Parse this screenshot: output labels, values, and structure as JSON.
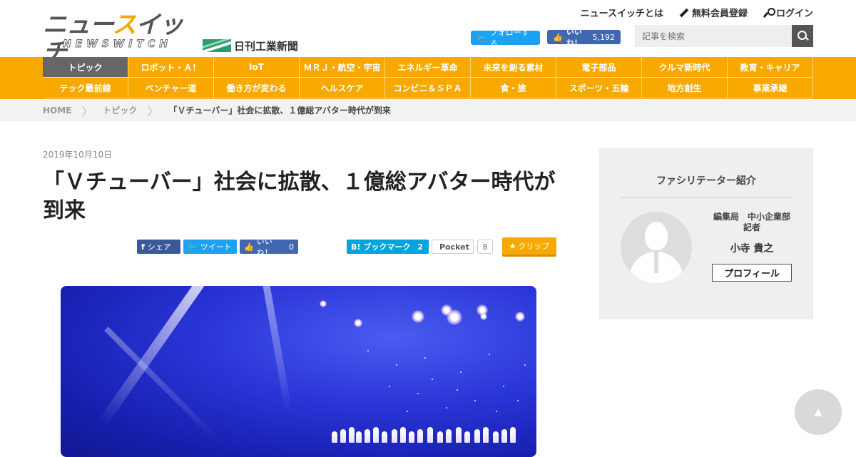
{
  "header": {
    "logo_text_a": "ニュー",
    "logo_text_hl": "ス",
    "logo_text_b": "イッチ",
    "logo_sub": "NEWSWITCH",
    "nikkan": "日刊工業新聞",
    "links": {
      "about": "ニュースイッチとは",
      "register": "無料会員登録",
      "login": "ログイン"
    },
    "twitter_follow": "フォローする",
    "fb_like": "いいね！",
    "fb_like_count": "5,192",
    "search_placeholder": "記事を検索"
  },
  "nav": {
    "items": [
      "トピック",
      "ロボット・Ａ！",
      "IoT",
      "ＭＲＪ・航空・宇宙",
      "エネルギー革命",
      "未来を創る素材",
      "電子部品",
      "クルマ新時代",
      "教育・キャリア",
      "テック最前線",
      "ベンチャー道",
      "働き方が変わる",
      "ヘルスケア",
      "コンビニ＆ＳＰＡ",
      "食・旅",
      "スポーツ・五輪",
      "地方創生",
      "事業承継"
    ],
    "active": "トピック"
  },
  "breadcrumb": {
    "home": "HOME",
    "section": "トピック",
    "current": "「Ｖチューバー」社会に拡散、１億総アバター時代が到来"
  },
  "article": {
    "date": "2019年10月10日",
    "title": "「Ｖチューバー」社会に拡散、１億総アバター時代が到来"
  },
  "share": {
    "fb": "シェア",
    "tw": "ツイート",
    "like": "いいね！",
    "like_count": "0",
    "hatena": "ブックマーク",
    "hatena_count": "2",
    "pocket": "Pocket",
    "pocket_count": "8",
    "clip": "クリップ"
  },
  "sidebar": {
    "title": "ファシリテーター紹介",
    "dept_line1": "編集局　中小企業部",
    "dept_line2": "記者",
    "name": "小寺 貴之",
    "profile_button": "プロフィール"
  },
  "colors": {
    "accent": "#f8a900",
    "nav_active": "#666666",
    "twitter": "#1da1f2",
    "facebook": "#4267b2",
    "hatena": "#00a4de"
  }
}
